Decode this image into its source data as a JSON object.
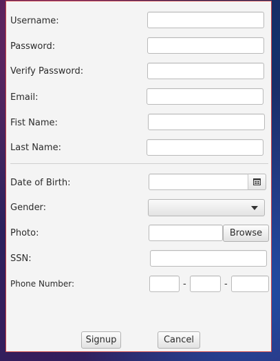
{
  "form": {
    "username_label": "Username:",
    "password_label": "Password:",
    "verify_password_label": "Verify Password:",
    "email_label": "Email:",
    "first_name_label": "Fist Name:",
    "last_name_label": "Last Name:",
    "dob_label": "Date of Birth:",
    "gender_label": "Gender:",
    "photo_label": "Photo:",
    "ssn_label": "SSN:",
    "phone_label": "Phone Number:",
    "phone_separator": "-",
    "browse_label": "Browse",
    "signup_label": "Signup",
    "cancel_label": "Cancel",
    "username_value": "",
    "password_value": "",
    "verify_password_value": "",
    "email_value": "",
    "first_name_value": "",
    "last_name_value": "",
    "dob_value": "",
    "gender_value": "",
    "photo_value": "",
    "ssn_value": "",
    "phone_part1": "",
    "phone_part2": "",
    "phone_part3": ""
  },
  "icons": {
    "date_picker": "calendar-icon",
    "gender_dropdown": "chevron-down-icon"
  },
  "colors": {
    "panel_border": "#d04848",
    "panel_bg": "#f4f4f4"
  }
}
